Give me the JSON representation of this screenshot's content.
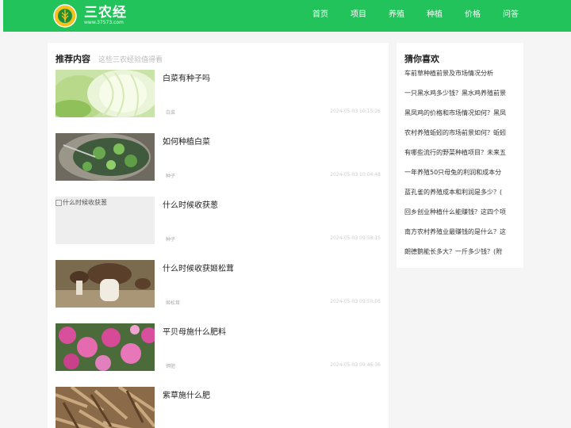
{
  "header": {
    "logo_text": "三农经",
    "logo_url": "www.37573.com",
    "nav": [
      "首页",
      "项目",
      "养殖",
      "种植",
      "价格",
      "问答"
    ]
  },
  "main": {
    "title": "推荐内容",
    "subtitle": "这些三农经验值得看",
    "articles": [
      {
        "title": "白菜有种子吗",
        "tag": "白菜",
        "date": "2024-05-03 10:15:26",
        "image": "cabbage"
      },
      {
        "title": "如何种植白菜",
        "tag": "种子",
        "date": "2024-05-03 10:04:48",
        "image": "bowl-plants"
      },
      {
        "title": "什么时候收获葱",
        "tag": "种子",
        "date": "2024-05-03 09:58:15",
        "image_alt": "什么时候收获葱"
      },
      {
        "title": "什么时候收获姬松茸",
        "tag": "姬松茸",
        "date": "2024-05-03 09:50:05",
        "image": "mushroom"
      },
      {
        "title": "平贝母施什么肥料",
        "tag": "钾肥",
        "date": "2024-05-03 09:46:36",
        "image": "pink-flowers"
      },
      {
        "title": "紫草施什么肥",
        "tag": "",
        "date": "",
        "image": "dried-roots"
      }
    ]
  },
  "sidebar": {
    "title": "猜你喜欢",
    "items": [
      "车前草种植前景及市场情况分析",
      "一只黑水鸡多少钱？黑水鸡养殖前景",
      "黑凤鸡的价格和市场情况如何？黑凤",
      "农村养殖蚯蚓的市场前景如何？蚯蚓",
      "有哪些流行的野菜种植项目？未来五",
      "一年养殖50只母兔的利润和成本分",
      "蓝孔雀的养殖成本和利润是多少？(",
      "回乡创业种植什么能赚钱？这四个项",
      "南方农村养殖业最赚钱的是什么？这",
      "朗德鹅能长多大？一斤多少钱？(附"
    ]
  },
  "colors": {
    "brand": "#21c35a",
    "background": "#f5f5f5"
  }
}
